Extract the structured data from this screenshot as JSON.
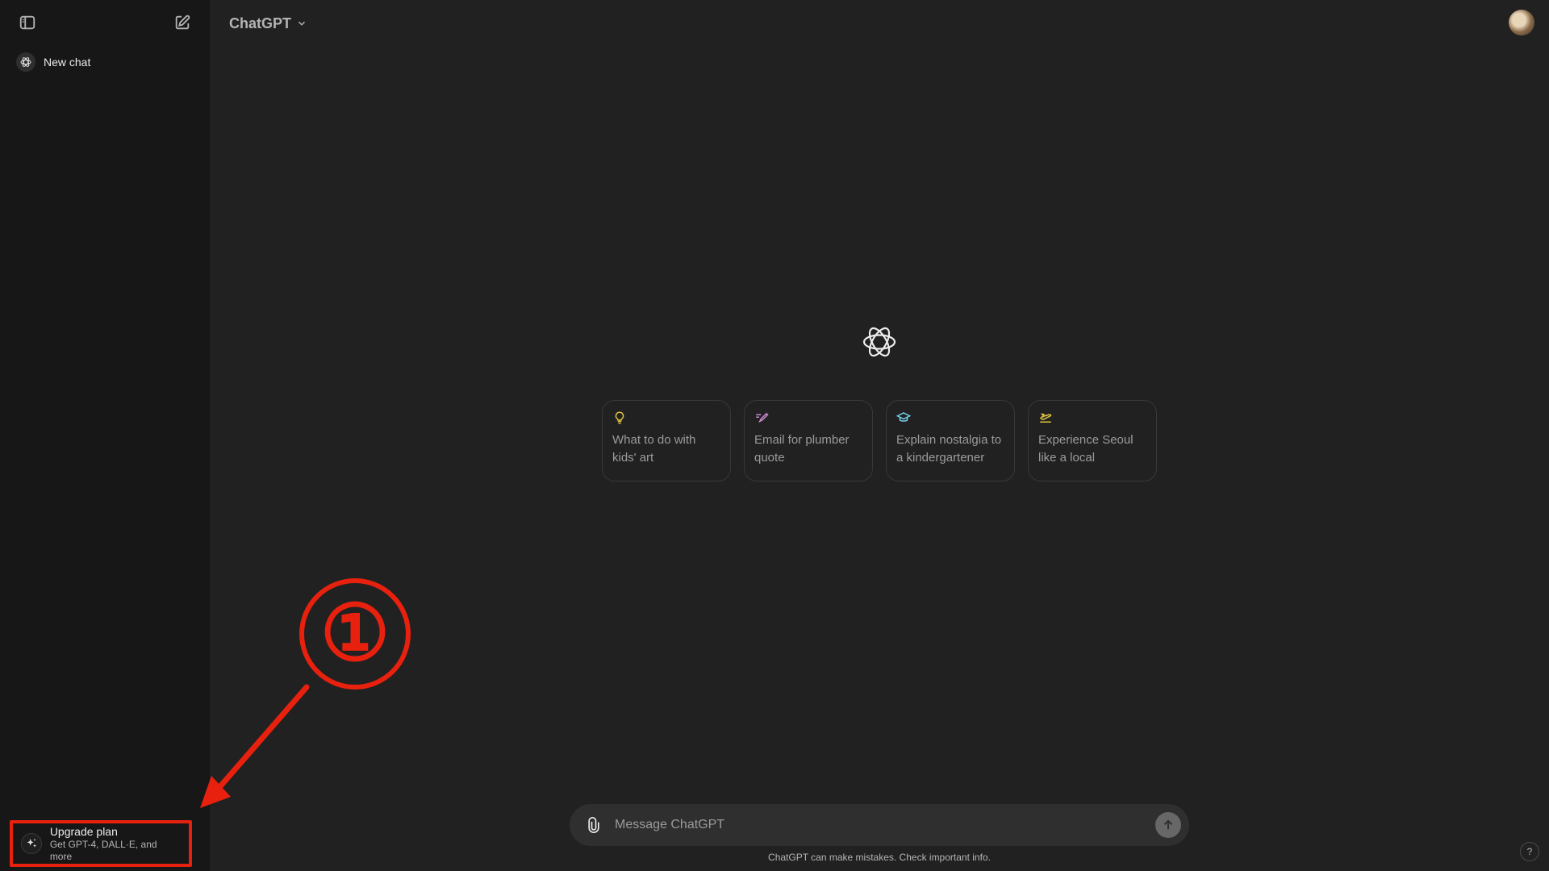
{
  "sidebar": {
    "new_chat_label": "New chat",
    "upgrade": {
      "title": "Upgrade plan",
      "subtitle": "Get GPT-4, DALL·E, and more"
    }
  },
  "header": {
    "model_name": "ChatGPT"
  },
  "suggestions": [
    {
      "text": "What to do with kids' art",
      "icon": "lightbulb-icon",
      "color": "#e2c541"
    },
    {
      "text": "Email for plumber quote",
      "icon": "pen-icon",
      "color": "#cb8bd0"
    },
    {
      "text": "Explain nostalgia to a kindergartener",
      "icon": "graduation-cap-icon",
      "color": "#76d0eb"
    },
    {
      "text": "Experience Seoul like a local",
      "icon": "airplane-icon",
      "color": "#e2c541"
    }
  ],
  "composer": {
    "placeholder": "Message ChatGPT"
  },
  "footer": {
    "disclaimer": "ChatGPT can make mistakes. Check important info.",
    "help_label": "?"
  },
  "annotation": {
    "step_label": "①",
    "color": "#e8210f"
  },
  "colors": {
    "background": "#212121",
    "sidebar": "#171717",
    "composer": "#2f2f2f"
  }
}
